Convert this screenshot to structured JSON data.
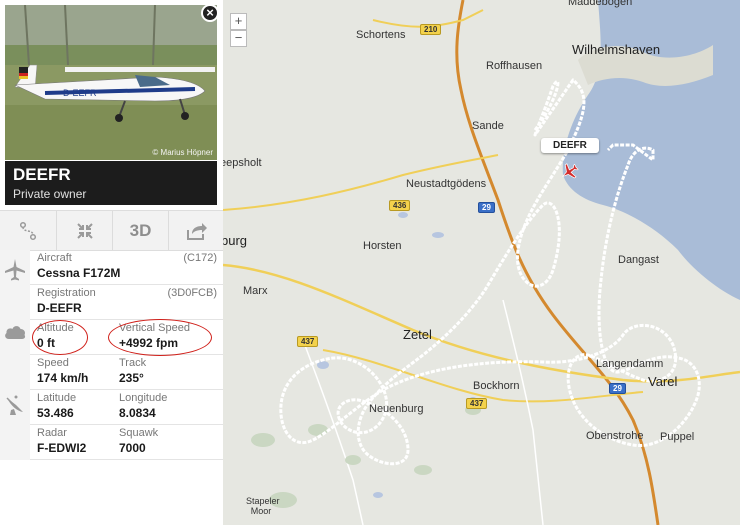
{
  "photo": {
    "credit": "© Marius Höpner",
    "registration_on_plane": "D-EEFR"
  },
  "header": {
    "callsign": "DEEFR",
    "owner": "Private owner"
  },
  "toolbar": {
    "route_icon": "route-icon",
    "collapse_icon": "collapse-icon",
    "view_3d_label": "3D",
    "share_icon": "share-icon"
  },
  "details": {
    "aircraft": {
      "label": "Aircraft",
      "value": "Cessna F172M",
      "code": "(C172)"
    },
    "registration": {
      "label": "Registration",
      "value": "D-EEFR",
      "code": "(3D0FCB)"
    },
    "altitude": {
      "label": "Altitude",
      "value": "0 ft"
    },
    "vertical_speed": {
      "label": "Vertical Speed",
      "value": "+4992 fpm"
    },
    "speed": {
      "label": "Speed",
      "value": "174 km/h"
    },
    "track": {
      "label": "Track",
      "value": "235°"
    },
    "latitude": {
      "label": "Latitude",
      "value": "53.486"
    },
    "longitude": {
      "label": "Longitude",
      "value": "8.0834"
    },
    "radar": {
      "label": "Radar",
      "value": "F-EDWI2"
    },
    "squawk": {
      "label": "Squawk",
      "value": "7000"
    }
  },
  "map": {
    "zoom_in": "+",
    "zoom_out": "−",
    "flight_label": "DEEFR",
    "places": {
      "schortens": "Schortens",
      "wilhelmshaven": "Wilhelmshaven",
      "maddebogen": "Maddebogen",
      "roffhausen": "Roffhausen",
      "sande": "Sande",
      "neustadtgodens": "Neustadtgödens",
      "horsten": "Horsten",
      "dangast": "Dangast",
      "marx": "Marx",
      "zetel": "Zetel",
      "bockhorn": "Bockhorn",
      "neuenburg": "Neuenburg",
      "langendamm": "Langendamm",
      "varel": "Varel",
      "obenstrohe": "Obenstrohe",
      "puppel": "Puppel",
      "stapeler_moor": "Stapeler Moor",
      "eepsholt": "eepsholt",
      "burg": "burg"
    },
    "roads": {
      "r210": "210",
      "r436": "436",
      "r437a": "437",
      "r437b": "437",
      "a29a": "29",
      "a29b": "29"
    }
  },
  "colors": {
    "annotation_circle": "#d0201a",
    "track_line": "#ffffff",
    "motorway": "#d4892e",
    "water": "#a9bcd7"
  }
}
